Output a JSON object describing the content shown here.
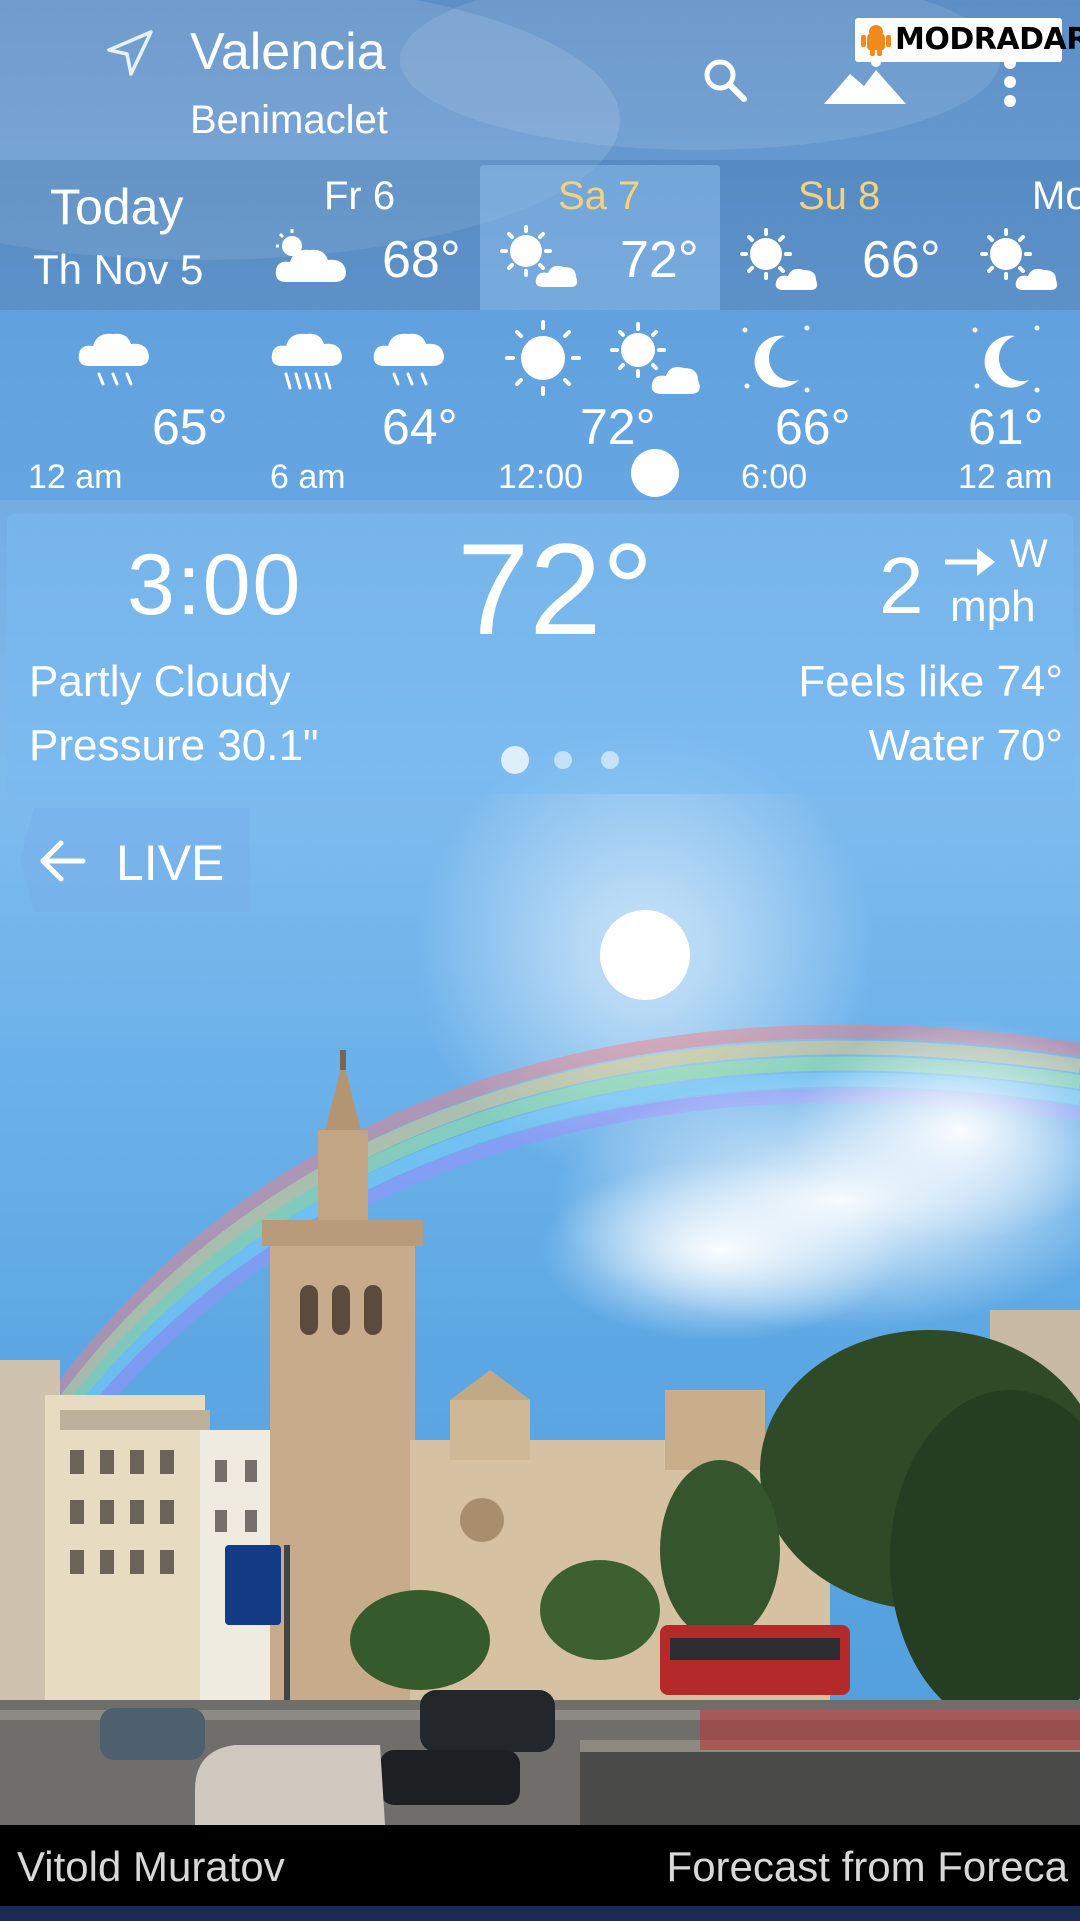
{
  "header": {
    "city": "Valencia",
    "district": "Benimaclet",
    "watermark": "MODRADAR",
    "icons": [
      "location-arrow-icon",
      "search-icon",
      "mountain-icon",
      "more-vert-icon"
    ]
  },
  "days": {
    "today_label": "Today",
    "today_date": "Th Nov 5",
    "items": [
      {
        "name": "Fr 6",
        "temp": "68°",
        "icon": "partly-cloudy-icon",
        "name_color": "#ffffff"
      },
      {
        "name": "Sa 7",
        "temp": "72°",
        "icon": "sun-cloud-icon",
        "name_color": "#f4d27a",
        "selected": true
      },
      {
        "name": "Su 8",
        "temp": "66°",
        "icon": "sun-cloud-icon",
        "name_color": "#f4d27a"
      },
      {
        "name": "Mo",
        "icon": "sun-cloud-icon",
        "name_color": "#ffffff"
      }
    ]
  },
  "hourly": {
    "temps": [
      "65°",
      "64°",
      "72°",
      "66°",
      "61°"
    ],
    "times": [
      "12 am",
      "6 am",
      "12:00",
      "6:00",
      "12 am"
    ],
    "icons": [
      "rain-icon",
      "heavy-rain-icon",
      "rain-icon",
      "sun-icon",
      "sun-cloud-icon",
      "moon-icon",
      "moon-icon"
    ]
  },
  "current": {
    "time": "3:00",
    "temp": "72°",
    "wind_speed": "2",
    "wind_dir": "W",
    "wind_unit": "mph",
    "condition": "Partly Cloudy",
    "pressure": "Pressure 30.1\"",
    "feels_like": "Feels like 74°",
    "water": "Water 70°",
    "page_indicator": {
      "current": 1,
      "total": 3
    }
  },
  "live": {
    "label": "LIVE"
  },
  "footer": {
    "credit": "Vitold Muratov",
    "source": "Forecast from Foreca"
  },
  "colors": {
    "accent_day": "#f4d27a",
    "panel": "#78b9f0",
    "footer_bg": "#000000"
  }
}
